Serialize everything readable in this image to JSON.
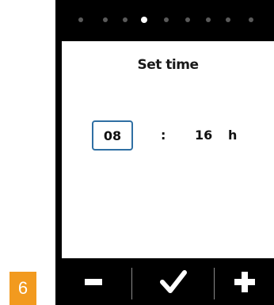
{
  "step_badge": "6",
  "dialog": {
    "title": "Set time",
    "hour": "08",
    "separator": ":",
    "minute": "16",
    "unit": "h"
  },
  "pagination": {
    "total": 9,
    "active_index": 3
  },
  "controls": {
    "decrease_icon": "minus-icon",
    "confirm_icon": "checkmark-icon",
    "increase_icon": "plus-icon"
  },
  "colors": {
    "device_bg": "#000000",
    "panel_bg": "#ffffff",
    "selection_border": "#2f6fa3",
    "badge_bg": "#f29a1f",
    "inactive_dot": "#5a5a5a",
    "active_dot": "#ffffff"
  }
}
